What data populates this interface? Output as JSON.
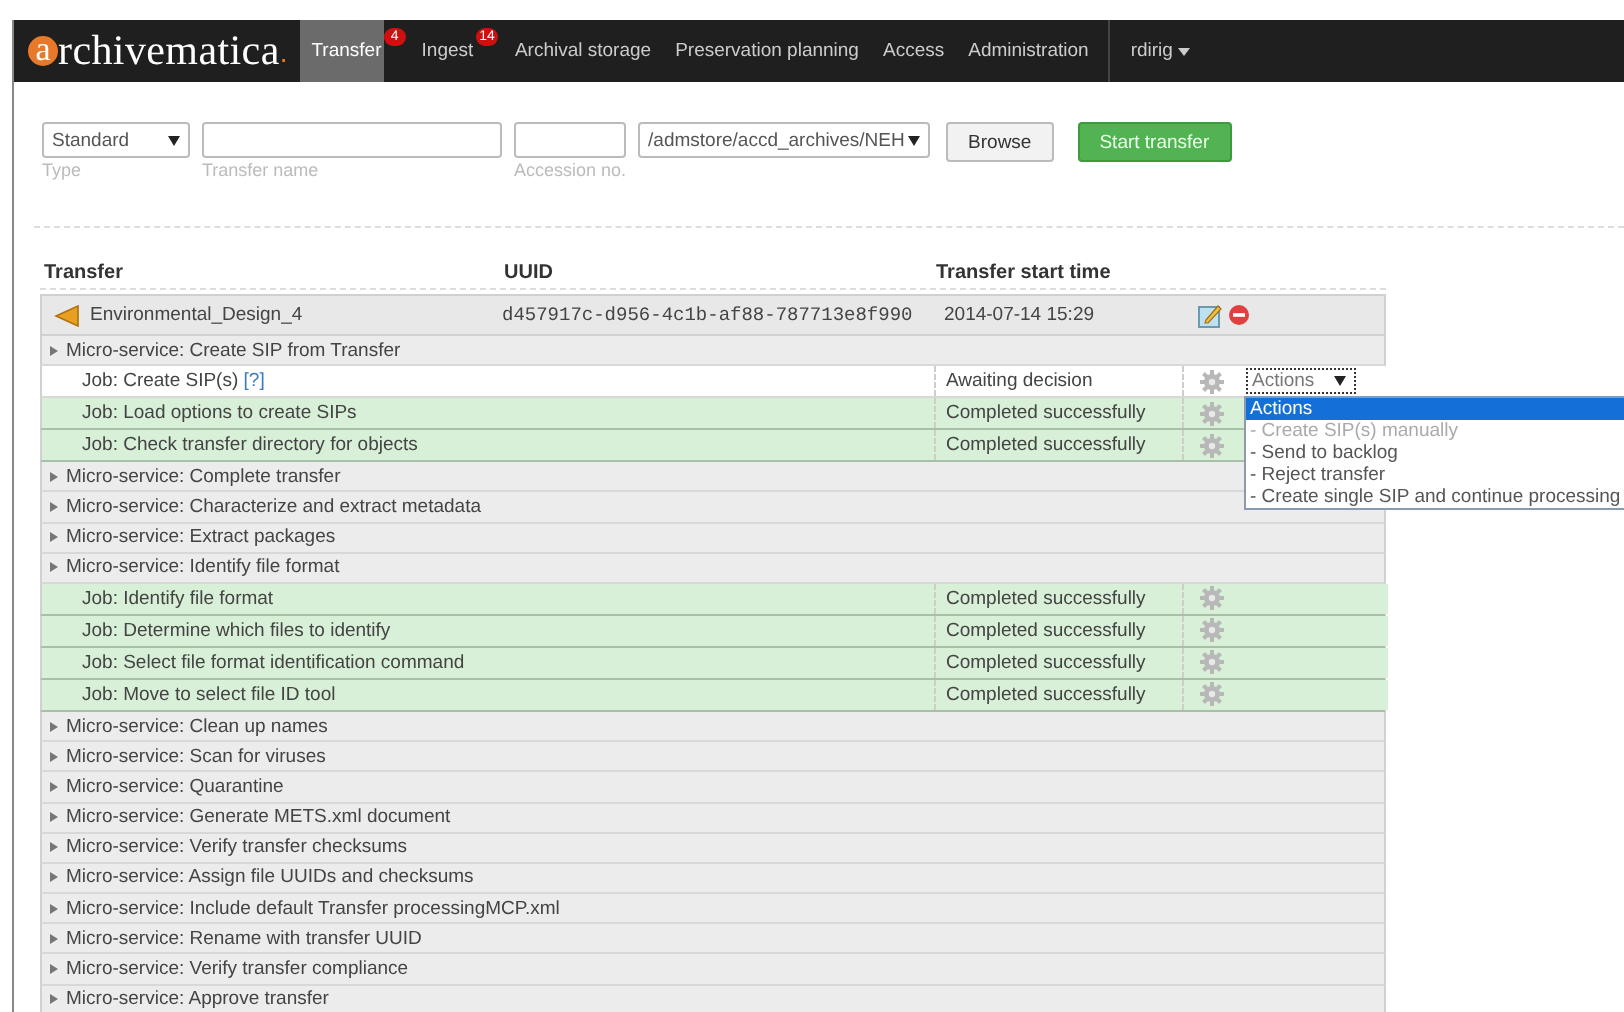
{
  "navbar": {
    "logo_initial": "a",
    "logo_rest": "rchivematica",
    "logo_dot": ".",
    "tabs": [
      {
        "label": "Transfer",
        "selected": true,
        "badge": "4"
      },
      {
        "label": "Ingest",
        "selected": false,
        "badge": "14"
      },
      {
        "label": "Archival storage",
        "selected": false
      },
      {
        "label": "Preservation planning",
        "selected": false
      },
      {
        "label": "Access",
        "selected": false
      },
      {
        "label": "Administration",
        "selected": false
      }
    ],
    "user_menu": "rdirig"
  },
  "form": {
    "type": {
      "value": "Standard",
      "label": "Type"
    },
    "transfer_name": {
      "label": "Transfer name"
    },
    "accession_no": {
      "label": "Accession no."
    },
    "path": {
      "value": "/admstore/accd_archives/NEH"
    },
    "buttons": [
      {
        "label": "Browse",
        "kind": "default"
      },
      {
        "label": "Start transfer",
        "kind": "primary"
      }
    ]
  },
  "table": {
    "columns": [
      "Transfer",
      "UUID",
      "Transfer start time"
    ],
    "transfer": {
      "name": "Environmental_Design_4",
      "uuid": "d457917c-d956-4c1b-af88-787713e8f990",
      "start_time": "2014-07-14 15:29"
    },
    "rows": [
      {
        "kind": "microservice",
        "label": "Micro-service: Create SIP from Transfer"
      },
      {
        "kind": "job",
        "label": "Job: Create SIP(s)",
        "help": "[?]",
        "status": "Awaiting decision",
        "completed": false,
        "actions": {
          "value": "Actions",
          "expanded": true,
          "options": [
            {
              "label": "Actions",
              "selected": true,
              "disabled": false
            },
            {
              "label": "- Create SIP(s) manually",
              "selected": false,
              "disabled": true
            },
            {
              "label": "- Send to backlog",
              "selected": false,
              "disabled": false
            },
            {
              "label": "- Reject transfer",
              "selected": false,
              "disabled": false
            },
            {
              "label": "- Create single SIP and continue processing",
              "selected": false,
              "disabled": false
            }
          ]
        }
      },
      {
        "kind": "job",
        "label": "Job: Load options to create SIPs",
        "status": "Completed successfully",
        "completed": true
      },
      {
        "kind": "job",
        "label": "Job: Check transfer directory for objects",
        "status": "Completed successfully",
        "completed": true
      },
      {
        "kind": "microservice",
        "label": "Micro-service: Complete transfer"
      },
      {
        "kind": "microservice",
        "label": "Micro-service: Characterize and extract metadata"
      },
      {
        "kind": "microservice",
        "label": "Micro-service: Extract packages"
      },
      {
        "kind": "microservice",
        "label": "Micro-service: Identify file format"
      },
      {
        "kind": "job",
        "label": "Job: Identify file format",
        "status": "Completed successfully",
        "completed": true
      },
      {
        "kind": "job",
        "label": "Job: Determine which files to identify",
        "status": "Completed successfully",
        "completed": true
      },
      {
        "kind": "job",
        "label": "Job: Select file format identification command",
        "status": "Completed successfully",
        "completed": true
      },
      {
        "kind": "job",
        "label": "Job: Move to select file ID tool",
        "status": "Completed successfully",
        "completed": true
      },
      {
        "kind": "microservice",
        "label": "Micro-service: Clean up names"
      },
      {
        "kind": "microservice",
        "label": "Micro-service: Scan for viruses"
      },
      {
        "kind": "microservice",
        "label": "Micro-service: Quarantine"
      },
      {
        "kind": "microservice",
        "label": "Micro-service: Generate METS.xml document"
      },
      {
        "kind": "microservice",
        "label": "Micro-service: Verify transfer checksums"
      },
      {
        "kind": "microservice",
        "label": "Micro-service: Assign file UUIDs and checksums"
      },
      {
        "kind": "microservice",
        "label": "Micro-service: Include default Transfer processingMCP.xml"
      },
      {
        "kind": "microservice",
        "label": "Micro-service: Rename with transfer UUID"
      },
      {
        "kind": "microservice",
        "label": "Micro-service: Verify transfer compliance"
      },
      {
        "kind": "microservice",
        "label": "Micro-service: Approve transfer"
      }
    ]
  }
}
